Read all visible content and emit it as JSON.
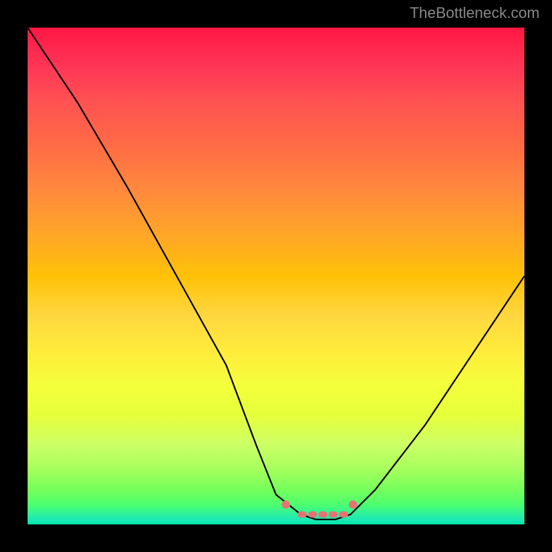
{
  "watermark": "TheBottleneck.com",
  "chart_data": {
    "type": "line",
    "title": "",
    "xlabel": "",
    "ylabel": "",
    "xlim": [
      0,
      100
    ],
    "ylim": [
      0,
      100
    ],
    "series": [
      {
        "name": "bottleneck-curve",
        "x": [
          0,
          10,
          20,
          30,
          40,
          46,
          50,
          55,
          58,
          62,
          65,
          70,
          80,
          90,
          100
        ],
        "y": [
          100,
          85,
          68,
          50,
          32,
          16,
          6,
          2,
          1,
          1,
          2,
          7,
          20,
          35,
          50
        ]
      }
    ],
    "annotations": [
      {
        "name": "flat-bottom-marker",
        "x_range": [
          55,
          64
        ],
        "y": 2
      },
      {
        "name": "left-elbow-marker",
        "x": 52,
        "y": 4
      },
      {
        "name": "right-elbow-marker",
        "x": 65.5,
        "y": 4
      }
    ],
    "colors": {
      "curve": "#000000",
      "marker": "#e57373",
      "gradient_top": "#ff1744",
      "gradient_bottom": "#00e5a8"
    }
  }
}
